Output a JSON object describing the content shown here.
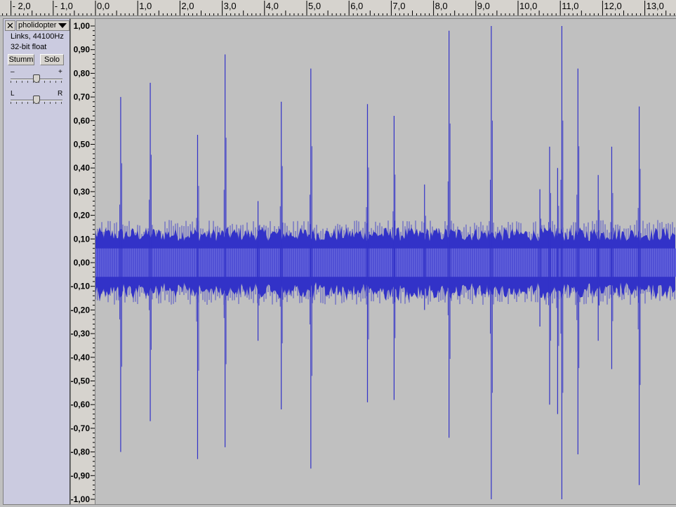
{
  "ruler": {
    "labels": [
      "- 2,0",
      "- 1,0",
      "0,0",
      "1,0",
      "2,0",
      "3,0",
      "4,0",
      "5,0",
      "6,0",
      "7,0",
      "8,0",
      "9,0",
      "10,0",
      "11,0",
      "12,0",
      "13,0"
    ]
  },
  "track": {
    "close_label": "✕",
    "name": "pholidopter",
    "info_line1": "Links, 44100Hz",
    "info_line2": "32-bit float",
    "mute_label": "Stumm",
    "solo_label": "Solo",
    "gain_minus": "–",
    "gain_plus": "+",
    "pan_left": "L",
    "pan_right": "R",
    "gain_level": 0.5,
    "pan_level": 0.5
  },
  "amplitude_axis": {
    "labels": [
      "1,00",
      "0,90",
      "0,80",
      "0,70",
      "0,60",
      "0,50",
      "0,40",
      "0,30",
      "0,20",
      "0,10",
      "0,00",
      "-0,10",
      "-0,20",
      "-0,30",
      "-0,40",
      "-0,50",
      "-0,60",
      "-0,70",
      "-0,80",
      "-0,90",
      "-1,00"
    ]
  },
  "waveform": {
    "time_start_s": -2.3,
    "time_view_start_s": 0.0,
    "time_view_end_s": 13.8,
    "noise_core": 0.06,
    "noise_envelope": 0.12,
    "spikes": [
      {
        "t": 0.58,
        "max": 0.7,
        "min": -0.8
      },
      {
        "t": 1.28,
        "max": 0.76,
        "min": -0.67
      },
      {
        "t": 2.4,
        "max": 0.54,
        "min": -0.83
      },
      {
        "t": 3.05,
        "max": 0.88,
        "min": -0.78
      },
      {
        "t": 3.83,
        "max": 0.26,
        "min": -0.33
      },
      {
        "t": 4.38,
        "max": 0.68,
        "min": -0.62
      },
      {
        "t": 5.08,
        "max": 0.82,
        "min": -0.87
      },
      {
        "t": 6.42,
        "max": 0.67,
        "min": -0.59
      },
      {
        "t": 7.05,
        "max": 0.62,
        "min": -0.58
      },
      {
        "t": 7.77,
        "max": 0.33,
        "min": -0.2
      },
      {
        "t": 8.35,
        "max": 0.98,
        "min": -0.74
      },
      {
        "t": 9.35,
        "max": 1.0,
        "min": -1.0
      },
      {
        "t": 10.5,
        "max": 0.31,
        "min": -0.27
      },
      {
        "t": 10.73,
        "max": 0.49,
        "min": -0.6
      },
      {
        "t": 10.92,
        "max": 0.4,
        "min": -0.64
      },
      {
        "t": 11.02,
        "max": 1.0,
        "min": -1.0
      },
      {
        "t": 11.4,
        "max": 0.82,
        "min": -0.81
      },
      {
        "t": 11.88,
        "max": 0.37,
        "min": -0.33
      },
      {
        "t": 12.2,
        "max": 0.49,
        "min": -0.45
      },
      {
        "t": 12.85,
        "max": 0.66,
        "min": -0.94
      },
      {
        "t": 13.8,
        "max": 0.23,
        "min": -0.25
      }
    ],
    "colors": {
      "background": "#c0c0c0",
      "wave": "#3232c8",
      "rms": "#6464dc",
      "ruler": "#d6d3ce"
    }
  }
}
